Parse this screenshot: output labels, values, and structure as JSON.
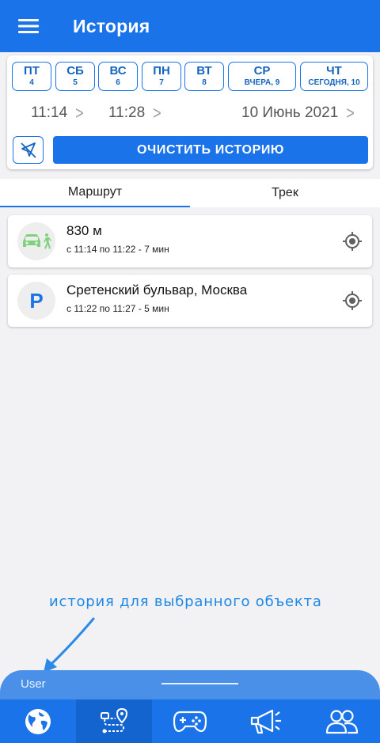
{
  "header": {
    "title": "История",
    "menu_icon": "hamburger-menu-icon"
  },
  "days": [
    {
      "name": "ПТ",
      "num": "4"
    },
    {
      "name": "СБ",
      "num": "5"
    },
    {
      "name": "ВС",
      "num": "6"
    },
    {
      "name": "ПН",
      "num": "7"
    },
    {
      "name": "ВТ",
      "num": "8"
    },
    {
      "name": "СР",
      "num": "ВЧЕРА, 9"
    },
    {
      "name": "ЧТ",
      "num": "СЕГОДНЯ, 10"
    }
  ],
  "time_range": {
    "start": "11:14",
    "end": "11:28",
    "date": "10 Июнь 2021"
  },
  "clear_button": "ОЧИСТИТЬ ИСТОРИЮ",
  "tabs": [
    {
      "label": "Маршрут",
      "active": true
    },
    {
      "label": "Трек",
      "active": false
    }
  ],
  "items": [
    {
      "title": "830 м",
      "subtitle": "с 11:14 по 11:22 - 7 мин",
      "icon": "car-walk-icon"
    },
    {
      "title": "Сретенский бульвар, Москва",
      "subtitle": "с 11:22 по 11:27 - 5 мин",
      "icon": "parking-icon",
      "icon_letter": "P"
    }
  ],
  "annotation": "история для выбранного объекта",
  "sheet": {
    "user": "User"
  },
  "colors": {
    "primary": "#1a73e8",
    "annotation": "#1e88e5"
  },
  "nav": [
    {
      "icon": "globe-icon",
      "active": false
    },
    {
      "icon": "route-history-icon",
      "active": true
    },
    {
      "icon": "gamepad-icon",
      "active": false
    },
    {
      "icon": "megaphone-icon",
      "active": false
    },
    {
      "icon": "users-icon",
      "active": false
    }
  ]
}
